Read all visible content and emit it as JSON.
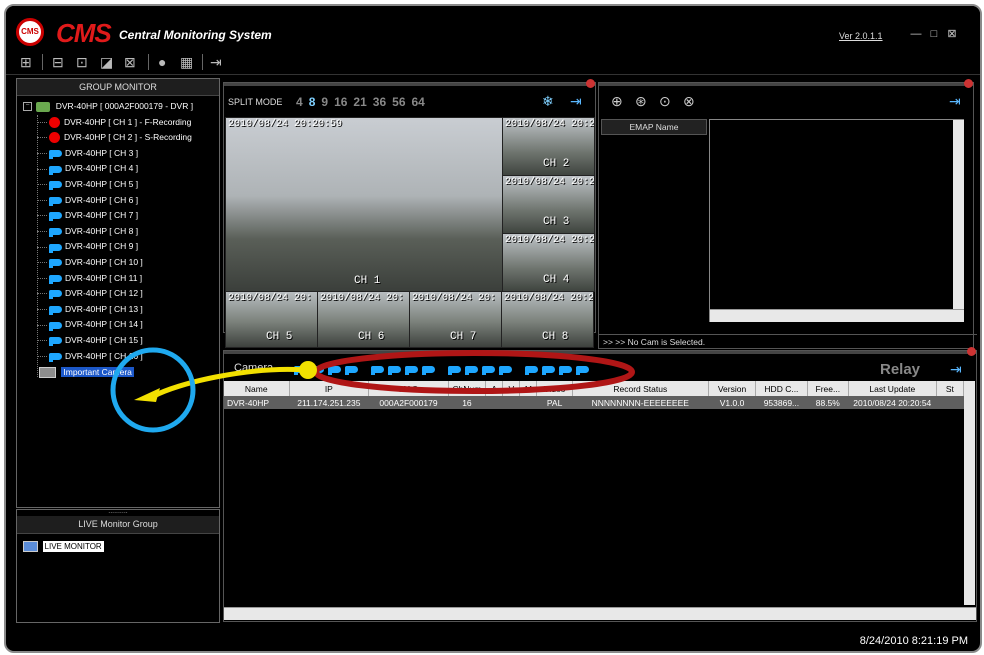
{
  "app": {
    "logo_badge": "CMS",
    "title": "CMS",
    "subtitle": "Central Monitoring System",
    "version": "Ver 2.0.1.1"
  },
  "window_controls": {
    "minimize": "—",
    "maximize": "□",
    "close": "⊠"
  },
  "group_monitor": {
    "header": "GROUP MONITOR",
    "root": "DVR-40HP [ 000A2F000179 - DVR ]",
    "channels": [
      {
        "label": "DVR-40HP [ CH 1 ]  - F-Recording",
        "icon": "recording-icon"
      },
      {
        "label": "DVR-40HP [ CH 2 ]  - S-Recording",
        "icon": "recording-icon"
      },
      {
        "label": "DVR-40HP [ CH 3 ]",
        "icon": "camera-icon"
      },
      {
        "label": "DVR-40HP [ CH 4 ]",
        "icon": "camera-icon"
      },
      {
        "label": "DVR-40HP [ CH 5 ]",
        "icon": "camera-icon"
      },
      {
        "label": "DVR-40HP [ CH 6 ]",
        "icon": "camera-icon"
      },
      {
        "label": "DVR-40HP [ CH 7 ]",
        "icon": "camera-icon"
      },
      {
        "label": "DVR-40HP [ CH 8 ]",
        "icon": "camera-icon"
      },
      {
        "label": "DVR-40HP [ CH 9 ]",
        "icon": "camera-icon"
      },
      {
        "label": "DVR-40HP [ CH 10 ]",
        "icon": "camera-icon"
      },
      {
        "label": "DVR-40HP [ CH 11 ]",
        "icon": "camera-icon"
      },
      {
        "label": "DVR-40HP [ CH 12 ]",
        "icon": "camera-icon"
      },
      {
        "label": "DVR-40HP [ CH 13 ]",
        "icon": "camera-icon"
      },
      {
        "label": "DVR-40HP [ CH 14 ]",
        "icon": "camera-icon"
      },
      {
        "label": "DVR-40HP [ CH 15 ]",
        "icon": "camera-icon"
      },
      {
        "label": "DVR-40HP [ CH 16 ]",
        "icon": "camera-icon"
      }
    ],
    "important": "Important Camera"
  },
  "live_group": {
    "header": "LIVE Monitor Group",
    "grip": "..........",
    "item": "LIVE MONITOR"
  },
  "split": {
    "label": "SPLIT MODE",
    "modes": [
      "4",
      "8",
      "9",
      "16",
      "21",
      "36",
      "56",
      "64"
    ]
  },
  "video": {
    "main": {
      "ts": "2010/08/24 20:20:59",
      "ch": "CH 1"
    },
    "side": [
      {
        "ts": "2010/08/24 20:2",
        "ch": "CH 2"
      },
      {
        "ts": "2010/08/24 20:2",
        "ch": "CH 3"
      },
      {
        "ts": "2010/08/24 20:2",
        "ch": "CH 4"
      }
    ],
    "bottom": [
      {
        "ts": "2010/08/24 20:",
        "ch": "CH 5"
      },
      {
        "ts": "2010/08/24 20:",
        "ch": "CH 6"
      },
      {
        "ts": "2010/08/24 20:",
        "ch": "CH 7"
      },
      {
        "ts": "2010/08/24 20:2",
        "ch": "CH 8"
      }
    ]
  },
  "emap": {
    "column": "EMAP Name",
    "status": ">> >> No Cam is Selected."
  },
  "camera_section": {
    "label": "Camera",
    "relay": "Relay",
    "ptz_count": 16
  },
  "table": {
    "headers": [
      "Name",
      "IP",
      "MAC",
      "ChNum",
      "A",
      "V",
      "M",
      "Video",
      "Record Status",
      "Version",
      "HDD C...",
      "Free...",
      "Last Update",
      "St"
    ],
    "rows": [
      [
        "DVR-40HP",
        "211.174.251.235",
        "000A2F000179",
        "16",
        "",
        "",
        "",
        "PAL",
        "NNNNNNNN-EEEEEEEE",
        "V1.0.0",
        "953869...",
        "88.5%",
        "2010/08/24 20:20:54",
        ""
      ]
    ]
  },
  "statusbar": {
    "datetime": "8/24/2010 8:21:19 PM"
  }
}
